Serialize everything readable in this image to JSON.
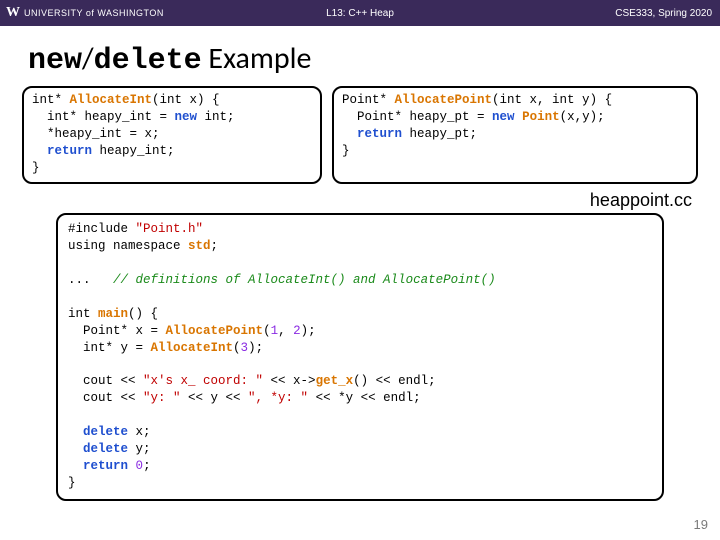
{
  "header": {
    "university": "UNIVERSITY of WASHINGTON",
    "lecture": "L13: C++ Heap",
    "course": "CSE333, Spring 2020"
  },
  "title": {
    "mono1": "new",
    "slash": "/",
    "mono2": "delete",
    "rest": " Example"
  },
  "box1": {
    "l1a": "int* ",
    "l1b": "AllocateInt",
    "l1c": "(int x) {",
    "l2a": "  int* heapy_int = ",
    "l2b": "new",
    "l2c": " int;",
    "l3": "  *heapy_int = x;",
    "l4a": "  ",
    "l4b": "return",
    "l4c": " heapy_int;",
    "l5": "}"
  },
  "box2": {
    "l1a": "Point* ",
    "l1b": "AllocatePoint",
    "l1c": "(int x, int y) {",
    "l2a": "  Point* heapy_pt = ",
    "l2b": "new",
    "l2c": " ",
    "l2d": "Point",
    "l2e": "(x,y);",
    "l3a": "  ",
    "l3b": "return",
    "l3c": " heapy_pt;",
    "l4": "}"
  },
  "filelabel": "heappoint.cc",
  "main": {
    "l1a": "#include ",
    "l1b": "\"Point.h\"",
    "l2a": "using namespace ",
    "l2b": "std",
    "l2c": ";",
    "blank": "",
    "l3a": "...   ",
    "l3b": "// definitions of AllocateInt() and AllocatePoint()",
    "l4a": "int ",
    "l4b": "main",
    "l4c": "() {",
    "l5a": "  Point* x = ",
    "l5b": "AllocatePoint",
    "l5c": "(",
    "l5d": "1",
    "l5e": ", ",
    "l5f": "2",
    "l5g": ");",
    "l6a": "  int* y = ",
    "l6b": "AllocateInt",
    "l6c": "(",
    "l6d": "3",
    "l6e": ");",
    "l7a": "  cout << ",
    "l7b": "\"x's x_ coord: \"",
    "l7c": " << x->",
    "l7d": "get_x",
    "l7e": "() << endl;",
    "l8a": "  cout << ",
    "l8b": "\"y: \"",
    "l8c": " << y << ",
    "l8d": "\", *y: \"",
    "l8e": " << *y << endl;",
    "l9a": "  ",
    "l9b": "delete",
    "l9c": " x;",
    "l10a": "  ",
    "l10b": "delete",
    "l10c": " y;",
    "l11a": "  ",
    "l11b": "return",
    "l11c": " ",
    "l11d": "0",
    "l11e": ";",
    "l12": "}"
  },
  "pagenum": "19"
}
